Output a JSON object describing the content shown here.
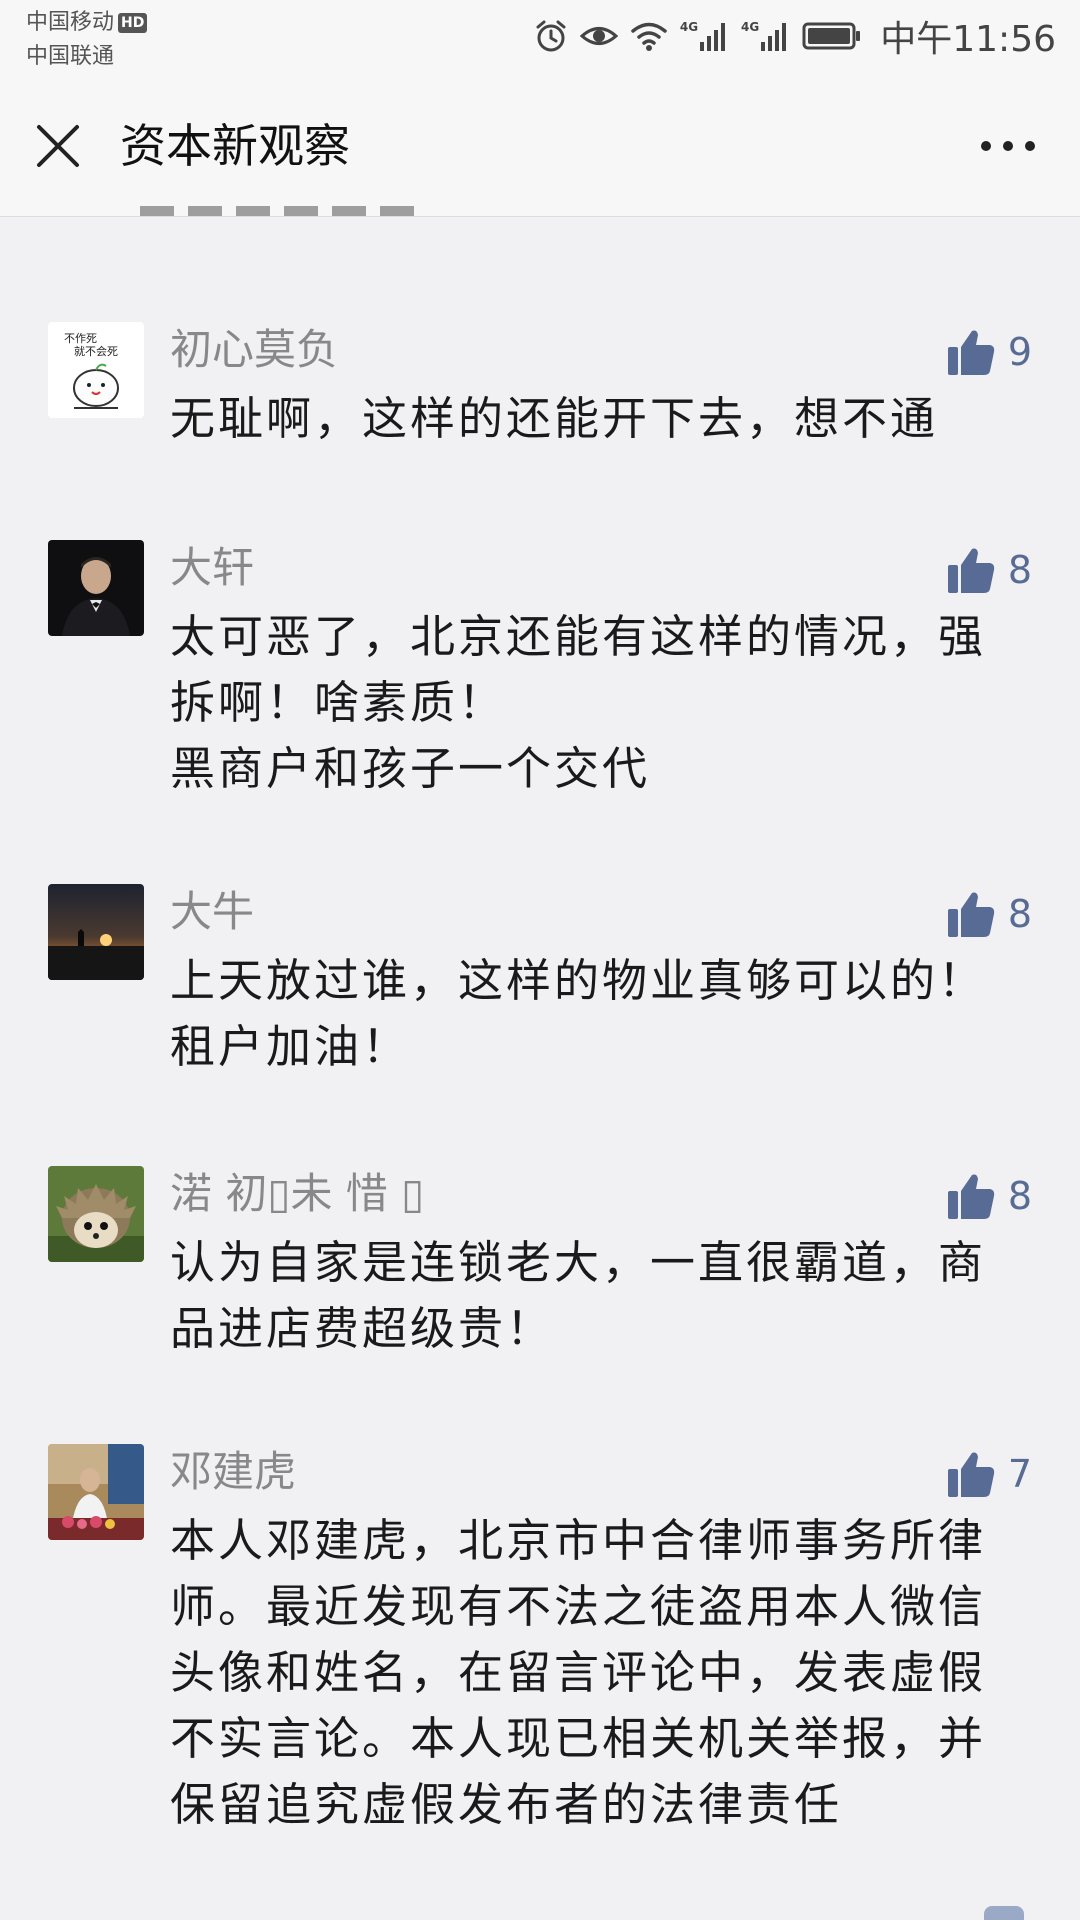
{
  "status_bar": {
    "carrier_1": "中国移动",
    "hd_label": "HD",
    "carrier_2": "中国联通",
    "net_1": "4G",
    "net_2": "4G",
    "time": "中午11:56"
  },
  "title_bar": {
    "title": "资本新观察"
  },
  "comments": [
    {
      "nickname": "初心莫负",
      "likes": "9",
      "text": "无耻啊，这样的还能开下去，想不通",
      "avatar_text_1": "不作死",
      "avatar_text_2": "就不会死"
    },
    {
      "nickname": "大轩",
      "likes": "8",
      "text": "太可恶了，北京还能有这样的情况，强\n拆啊！啥素质！\n黑商户和孩子一个交代"
    },
    {
      "nickname": "大牛",
      "likes": "8",
      "text": "上天放过谁，这样的物业真够可以的！\n租户加油！"
    },
    {
      "nickname": "渃 初▯未 惜 ▯",
      "likes": "8",
      "text": "认为自家是连锁老大，一直很霸道，商\n品进店费超级贵！"
    },
    {
      "nickname": "邓建虎",
      "likes": "7",
      "text": "本人邓建虎，北京市中合律师事务所律\n师。最近发现有不法之徒盗用本人微信\n头像和姓名，在留言评论中，发表虚假\n不实言论。本人现已相关机关举报，并\n保留追究虚假发布者的法律责任"
    }
  ],
  "colors": {
    "like_blue": "#576b95",
    "nickname_gray": "#888888",
    "background": "#f1f1f3"
  }
}
